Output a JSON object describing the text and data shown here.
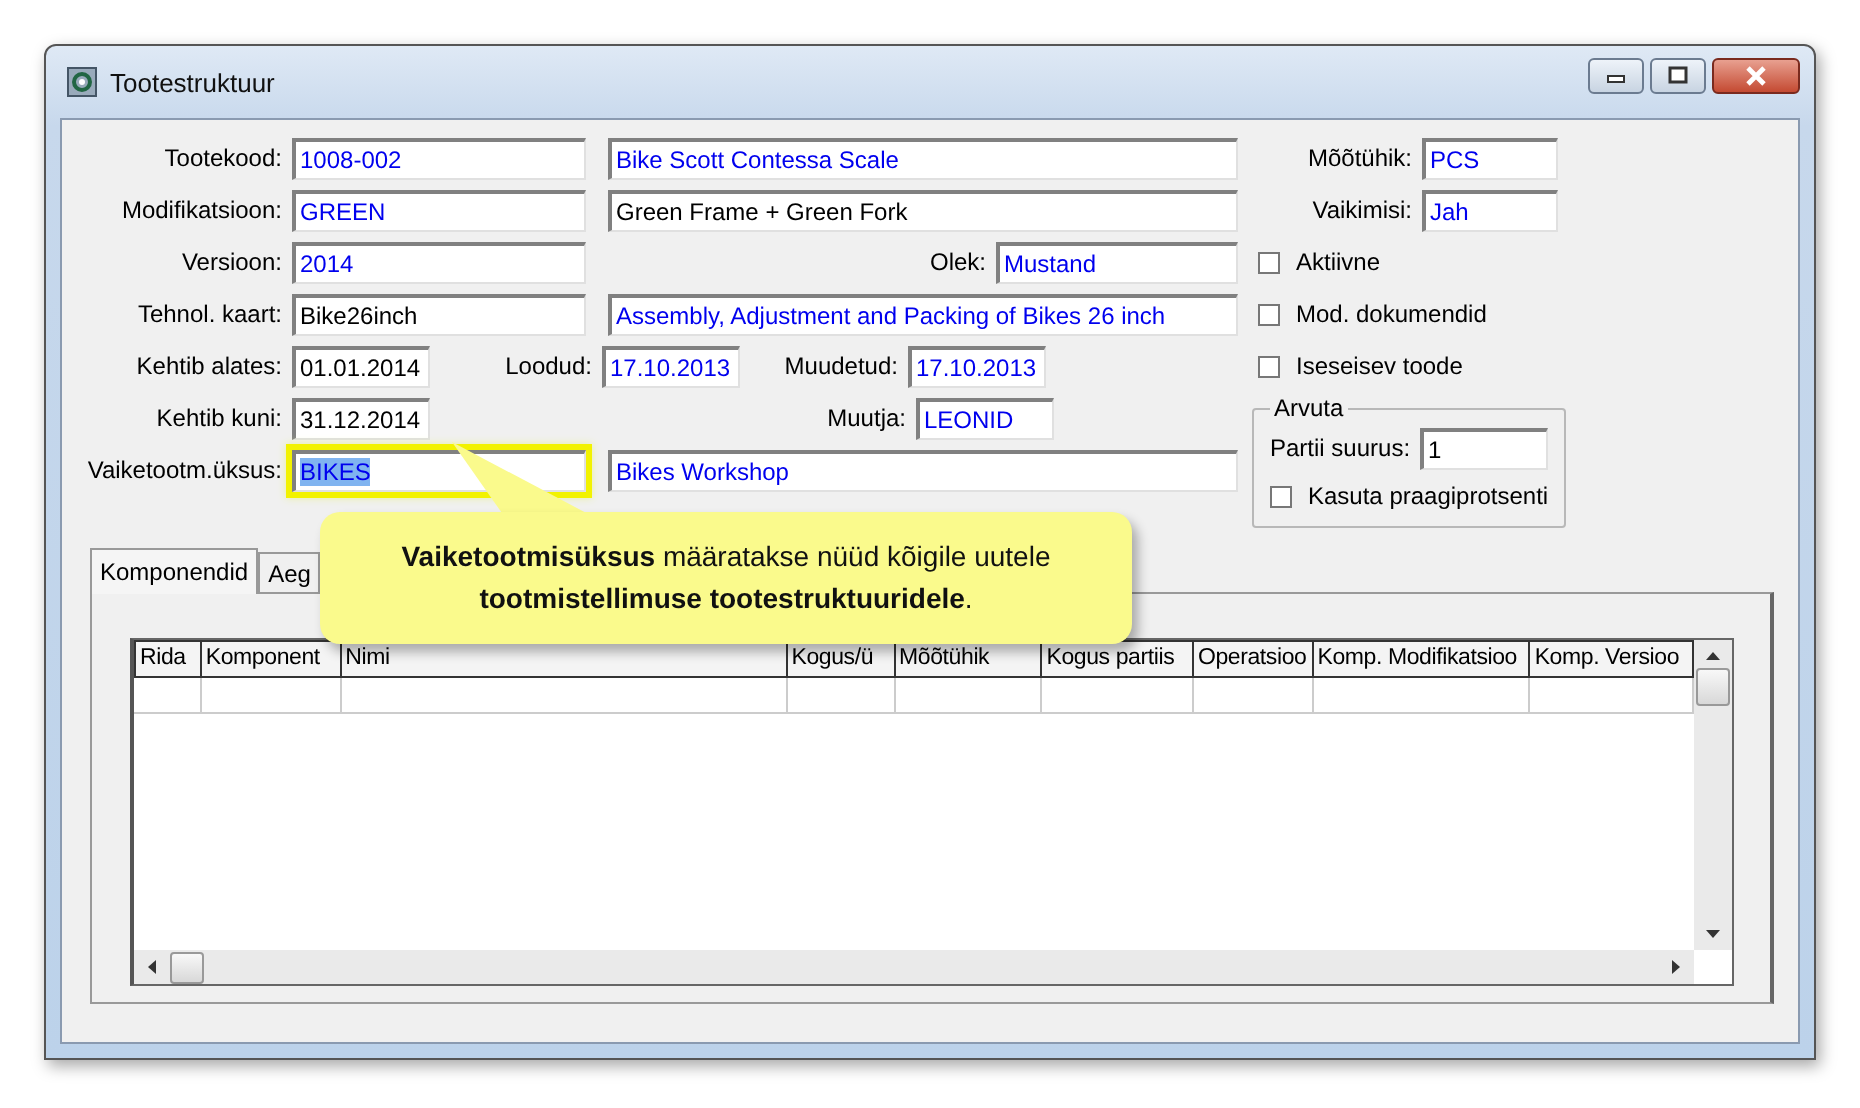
{
  "window": {
    "title": "Tootestruktuur"
  },
  "form": {
    "product_code": {
      "label": "Tootekood:",
      "value": "1008-002",
      "lookup": true
    },
    "product_name": {
      "value": "Bike Scott Contessa Scale",
      "lookup": true
    },
    "modification": {
      "label": "Modifikatsioon:",
      "value": "GREEN",
      "lookup": true
    },
    "modification_name": {
      "value": "Green Frame + Green Fork",
      "lookup": false
    },
    "version": {
      "label": "Versioon:",
      "value": "2014",
      "lookup": true
    },
    "status": {
      "label": "Olek:",
      "value": "Mustand",
      "lookup": true
    },
    "routing": {
      "label": "Tehnol. kaart:",
      "value": "Bike26inch",
      "lookup": false
    },
    "routing_name": {
      "value": "Assembly, Adjustment and Packing of Bikes 26 inch",
      "lookup": true
    },
    "valid_from": {
      "label": "Kehtib alates:",
      "value": "01.01.2014",
      "lookup": false
    },
    "created": {
      "label": "Loodud:",
      "value": "17.10.2013",
      "lookup": true
    },
    "modified": {
      "label": "Muudetud:",
      "value": "17.10.2013",
      "lookup": true
    },
    "valid_to": {
      "label": "Kehtib kuni:",
      "value": "31.12.2014",
      "lookup": false
    },
    "modifier": {
      "label": "Muutja:",
      "value": "LEONID",
      "lookup": true
    },
    "production_unit": {
      "label": "Vaiketootm.üksus:",
      "value": "BIKES",
      "lookup": true,
      "highlighted": true
    },
    "production_unit_name": {
      "value": "Bikes Workshop",
      "lookup": true
    },
    "unit": {
      "label": "Mõõtühik:",
      "value": "PCS",
      "lookup": true
    },
    "default": {
      "label": "Vaikimisi:",
      "value": "Jah",
      "lookup": true
    }
  },
  "checkboxes": [
    {
      "label": "Aktiivne",
      "checked": false
    },
    {
      "label": "Mod. dokumendid",
      "checked": false
    },
    {
      "label": "Iseseisev toode",
      "checked": false
    }
  ],
  "calculate": {
    "title": "Arvuta",
    "batch_label": "Partii suurus:",
    "batch_value": "1",
    "scrap": {
      "label": "Kasuta praagiprotsenti",
      "checked": false
    }
  },
  "tabs": [
    {
      "label": "Komponendid",
      "selected": true
    },
    {
      "label": "Aeg",
      "selected": false
    }
  ],
  "table": {
    "columns": [
      "Rida",
      "Komponent",
      "Nimi",
      "Kogus/ü",
      "Mõõtühik",
      "Kogus partiis",
      "Operatsioo",
      "Komp. Modifikatsioo",
      "Komp. Versioo"
    ]
  },
  "callout": {
    "text": "**Vaiketootmisüksus** määratakse nüüd kõigile uutele **tootmistellimuse tootestruktuuridele**."
  }
}
